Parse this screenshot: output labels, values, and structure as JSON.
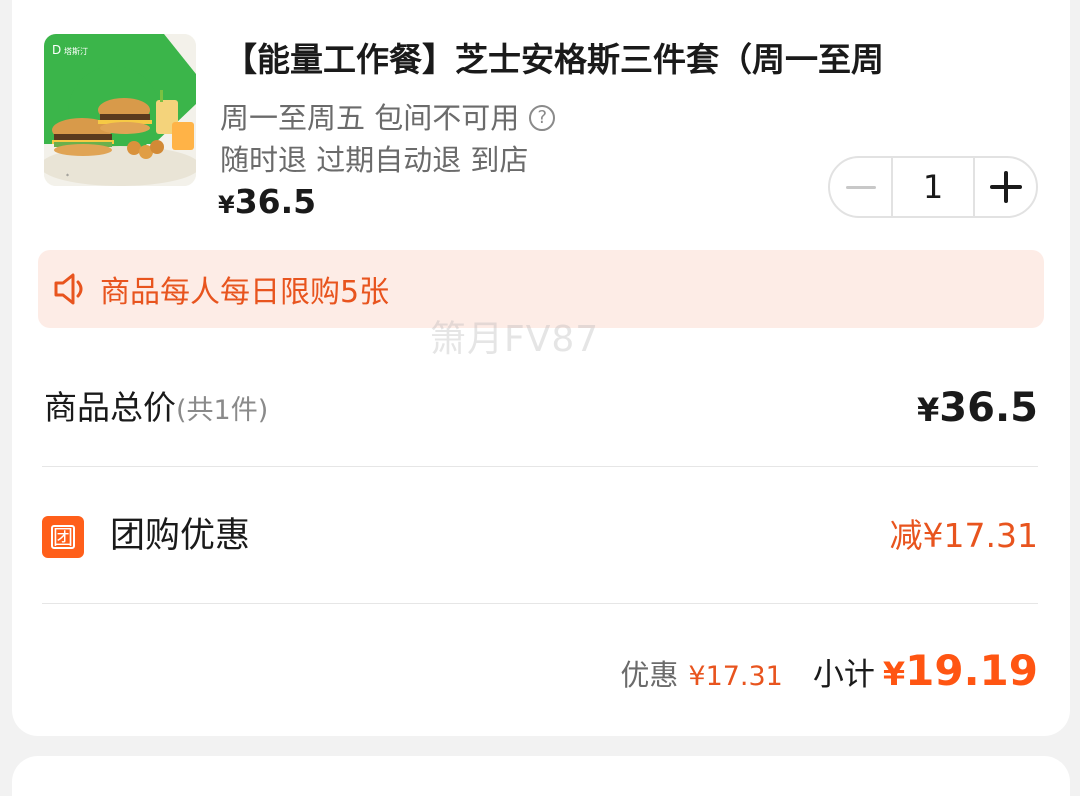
{
  "product": {
    "title": "【能量工作餐】芝士安格斯三件套（周一至周",
    "availability": "周一至周五 包间不可用",
    "policy": "随时退 过期自动退 到店",
    "price_symbol": "¥",
    "price": "36.5",
    "quantity": "1",
    "thumbnail_icon": "burger-combo-image"
  },
  "notice": {
    "text": "商品每人每日限购5张",
    "icon": "speaker-icon"
  },
  "watermark": "箫月FV87",
  "summary": {
    "total_label": "商品总价",
    "total_count": "(共1件)",
    "total_symbol": "¥",
    "total_value": "36.5",
    "discount_badge": "团",
    "discount_label": "团购优惠",
    "discount_value": "减¥17.31",
    "saved_label": "优惠",
    "saved_value": "¥17.31",
    "subtotal_label": "小计",
    "subtotal_symbol": "¥",
    "subtotal_value": "19.19"
  },
  "colors": {
    "accent": "#ff5512",
    "notice_bg": "#fdece6",
    "brand_green": "#3bb54a"
  }
}
